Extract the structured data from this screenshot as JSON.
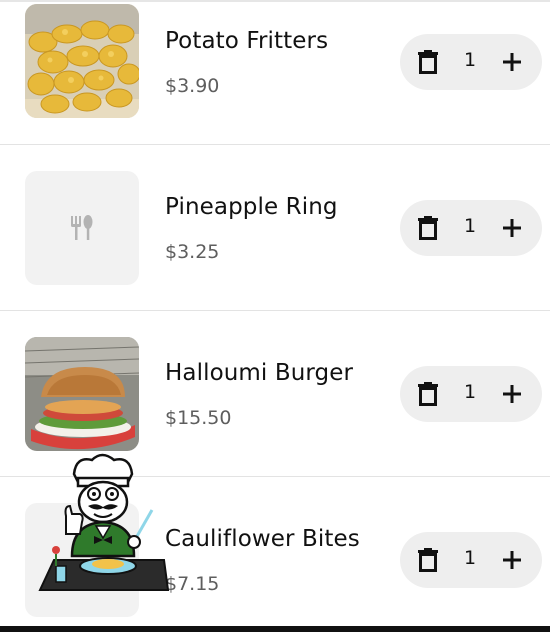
{
  "cart": {
    "items": [
      {
        "name": "Potato Fritters",
        "price": "$3.90",
        "quantity": "1",
        "image": "fritters-photo"
      },
      {
        "name": "Pineapple Ring",
        "price": "$3.25",
        "quantity": "1",
        "image": "placeholder-fork-knife-icon"
      },
      {
        "name": "Halloumi Burger",
        "price": "$15.50",
        "quantity": "1",
        "image": "burger-photo"
      },
      {
        "name": "Cauliflower Bites",
        "price": "$7.15",
        "quantity": "1",
        "image": "placeholder"
      }
    ]
  },
  "icons": {
    "remove": "trash-icon",
    "increment": "plus-icon",
    "overlay": "chef-mascot-icon"
  },
  "colors": {
    "stepper_bg": "#eeeeee",
    "price_text": "#5e5e5e",
    "placeholder_bg": "#f2f2f2"
  }
}
